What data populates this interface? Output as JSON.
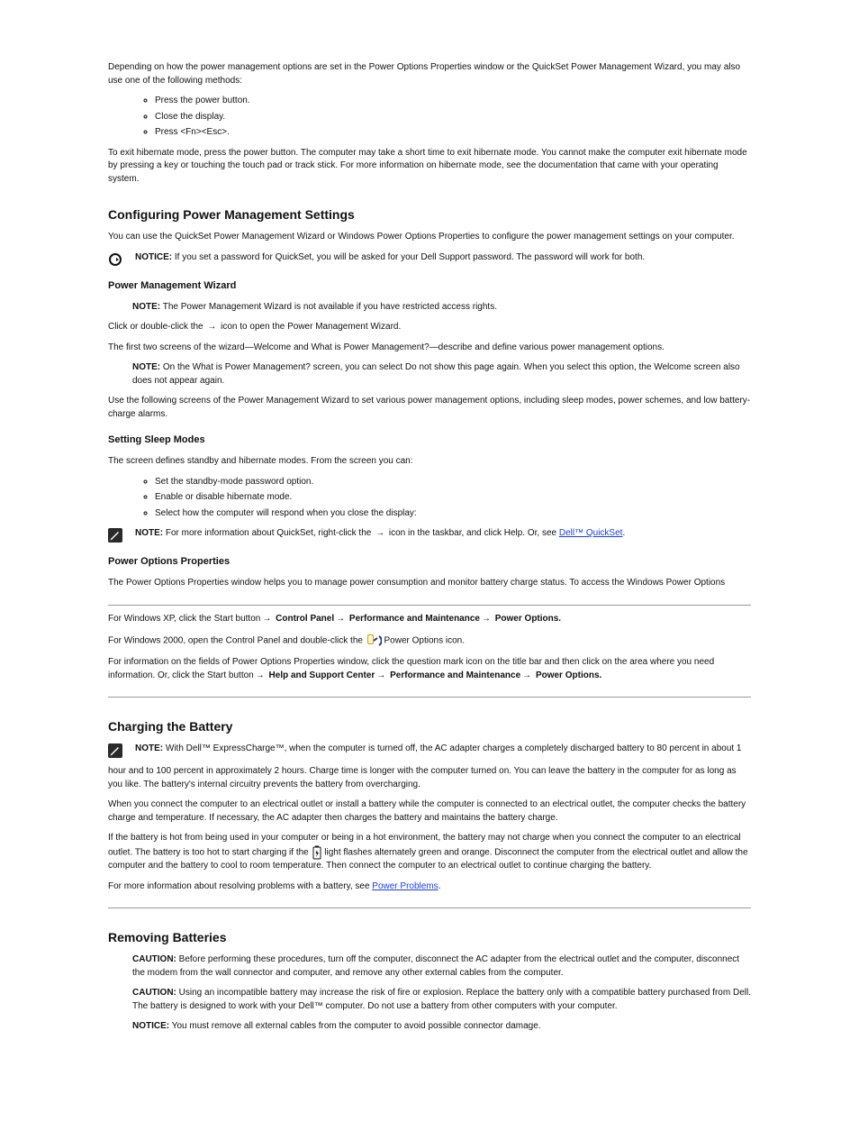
{
  "p1": "Depending on how the power management options are set in the Power Options Properties window or the QuickSet Power Management Wizard, you may also use one of the following methods:",
  "bul1": [
    "Press the power button.",
    "Close the display.",
    "Press <Fn><Esc>."
  ],
  "p2": "To exit hibernate mode, press the power button. The computer may take a short time to exit hibernate mode. You cannot make the computer exit hibernate mode by pressing a key or touching the touch pad or track stick. For more information on hibernate mode, see the documentation that came with your operating system.",
  "h2a": "Configuring Power Management Settings",
  "p3": "You can use the QuickSet Power Management Wizard or Windows Power Options Properties to configure the power management settings on your computer.",
  "notice": {
    "label": "NOTICE:",
    "text": " If you set a password for QuickSet, you will be asked for your Dell Support password. The password will work for both."
  },
  "h3a": "Power Management Wizard",
  "note1": {
    "label": "NOTE:",
    "text": " The Power Management Wizard is not available if you have restricted access rights."
  },
  "p4a": "Click or double-click the ",
  "p4b": " icon to open the Power Management Wizard.",
  "p5": "The first two screens of the wizard—Welcome and What is Power Management?—describe and define various power management options.",
  "note2": {
    "label": "NOTE:",
    "text": " On the What is Power Management? screen, you can select Do not show this page again. When you select this option, the Welcome screen also does not appear again."
  },
  "p6": "Use the following screens of the Power Management Wizard to set various power management options, including sleep modes, power schemes, and low battery-charge alarms.",
  "h3b": "Setting Sleep Modes",
  "p7": "The screen defines standby and hibernate modes. From the screen you can:",
  "bul2": [
    "Set the standby-mode password option.",
    "Enable or disable hibernate mode.",
    "Select how the computer will respond when you close the display:"
  ],
  "note3a": {
    "label": "NOTE:",
    "text": " For more information about QuickSet, right-click the "
  },
  "note3b": " icon in the taskbar, and click Help. Or, see ",
  "note3link": "Dell™ QuickSet",
  "note3c": ".",
  "h3c": "Power Options Properties",
  "p8": "The Power Options Properties window helps you to manage power consumption and monitor battery charge status. To access the Windows Power Options",
  "p9a": "For Windows XP, click the Start button",
  "p9b": "Control Panel",
  "p9c": "Performance and Maintenance",
  "p9d": "Power Options.",
  "p10a": "For Windows 2000, open the Control Panel and double-click the ",
  "p10b": " Power Options icon.",
  "p11a": "For information on the fields of Power Options Properties window, click the question mark icon on the title bar and then click on the area where you need information. Or, click the Start button",
  "p11b": "Help and Support Center",
  "p11c": "Performance and Maintenance",
  "p11d": "Power Options.",
  "h2b": "Charging the Battery",
  "note4": {
    "label": "NOTE:",
    "text": " With Dell™ ExpressCharge™, when the computer is turned off, the AC adapter charges a completely discharged battery to 80 percent in about 1"
  },
  "p12": "hour and to 100 percent in approximately 2 hours. Charge time is longer with the computer turned on. You can leave the battery in the computer for as long as you like. The battery's internal circuitry prevents the battery from overcharging.",
  "p13": "When you connect the computer to an electrical outlet or install a battery while the computer is connected to an electrical outlet, the computer checks the battery charge and temperature. If necessary, the AC adapter then charges the battery and maintains the battery charge.",
  "p14a": "If the battery is hot from being used in your computer or being in a hot environment, the battery may not charge when you connect the computer to an electrical outlet. The battery is too hot to start charging if the ",
  "p14b": " light flashes alternately green and orange. Disconnect the computer from the electrical outlet and allow the computer and the battery to cool to room temperature. Then connect the computer to an electrical outlet to continue charging the battery.",
  "p15a": "For more information about resolving problems with a battery, see ",
  "p15link": "Power Problems",
  "p15b": ".",
  "h2c": "Removing Batteries",
  "caution1": {
    "label": "CAUTION:",
    "text": " Before performing these procedures, turn off the computer, disconnect the AC adapter from the electrical outlet and the computer, disconnect the modem from the wall connector and computer, and remove any other external cables from the computer."
  },
  "caution2": {
    "label": "CAUTION:",
    "text": " Using an incompatible battery may increase the risk of fire or explosion. Replace the battery only with a compatible battery purchased from Dell. The battery is designed to work with your Dell™ computer. Do not use a battery from other computers with your computer."
  },
  "notice2": {
    "label": "NOTICE:",
    "text": " You must remove all external cables from the computer to avoid possible connector damage."
  }
}
